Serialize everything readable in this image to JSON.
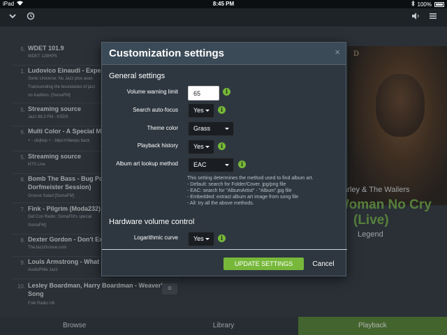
{
  "status_bar": {
    "device": "iPad",
    "time": "8:45 PM",
    "battery": "100%"
  },
  "icons": {
    "collapse": "chevron-down-icon",
    "timer": "clock-icon",
    "volume": "volume-icon",
    "menu": "hamburger-menu-icon",
    "close": "close-icon",
    "info": "info-icon",
    "mic": "microphone-icon"
  },
  "playlist": [
    {
      "num": "5.",
      "title": "WDET 101.9",
      "sub": [
        "WDET 128HPS"
      ]
    },
    {
      "num": "1.",
      "title": "Ludovico Einaudi - Experien",
      "sub": [
        "Sonic Universe: Nu Jazz plus avan",
        "Transcending the boundaries of jazz",
        "on tradition. [SomaFM]"
      ]
    },
    {
      "num": "5.",
      "title": "Streaming source",
      "sub": [
        "Jazz 88.3 FM - KSDS"
      ]
    },
    {
      "num": "6.",
      "title": "Multi Color - A Special Mon",
      "sub": [
        "+ - cliqhop + - blips'n'bleeps back"
      ]
    },
    {
      "num": "5.",
      "title": "Streaming source",
      "sub": [
        "NTS Live"
      ]
    },
    {
      "num": "8.",
      "title": "Bomb The Bass - Bug Powd",
      "title2": "Dorfmeister Session)",
      "sub": [
        "Groove Salad [SomaFM]"
      ]
    },
    {
      "num": "7.",
      "title": "Fink - Pilgrim (Moda232)",
      "sub": [
        "Def Con Radio: SomaFM's special",
        "SomaFM]"
      ]
    },
    {
      "num": "8.",
      "title": "Dexter Gordon - Don't Expl",
      "sub": [
        "TheJazzGroove.com"
      ]
    },
    {
      "num": "9.",
      "title": "Louis Armstrong - What a w",
      "sub": [
        "AudioPhile Jazz"
      ]
    },
    {
      "num": "10.",
      "title": "Lesley Boardman, Harry Boardman - Weaver's",
      "title2": "Song",
      "sub": [
        "Folk Radio UK"
      ]
    }
  ],
  "now_playing": {
    "cover_label": "D",
    "artist": "Marley & The Wailers",
    "title_line1": "Woman No Cry",
    "title_line2": "(Live)",
    "album": "Legend"
  },
  "tabs": [
    "Browse",
    "Library",
    "Playback"
  ],
  "modal": {
    "title": "Customization settings",
    "close_label": "×",
    "general_section": "General settings",
    "volume_warning_label": "Volume warning limit",
    "volume_warning_value": "65",
    "search_autofocus_label": "Search auto-focus",
    "search_autofocus_value": "Yes",
    "theme_color_label": "Theme color",
    "theme_color_value": "Grass",
    "playback_history_label": "Playback history",
    "playback_history_value": "Yes",
    "album_art_label": "Album art lookup method",
    "album_art_value": "EAC",
    "help_lines": [
      "This setting determines the method used to find album art.",
      "- Default: search for Folder/Cover. jpg/png file",
      "- EAC: search for \"AlbumArtist\" - \"Album\".jpg file",
      "- Embedded: extract album art image from song file",
      "- All: try all the above methods."
    ],
    "hardware_section": "Hardware volume control",
    "log_curve_label": "Logarithmic curve",
    "log_curve_value": "Yes",
    "update_button": "UPDATE SETTINGS",
    "cancel_button": "Cancel"
  },
  "colors": {
    "accent": "#77b83a",
    "modal_bg": "#2e3740",
    "modal_header": "#3b4a57"
  }
}
